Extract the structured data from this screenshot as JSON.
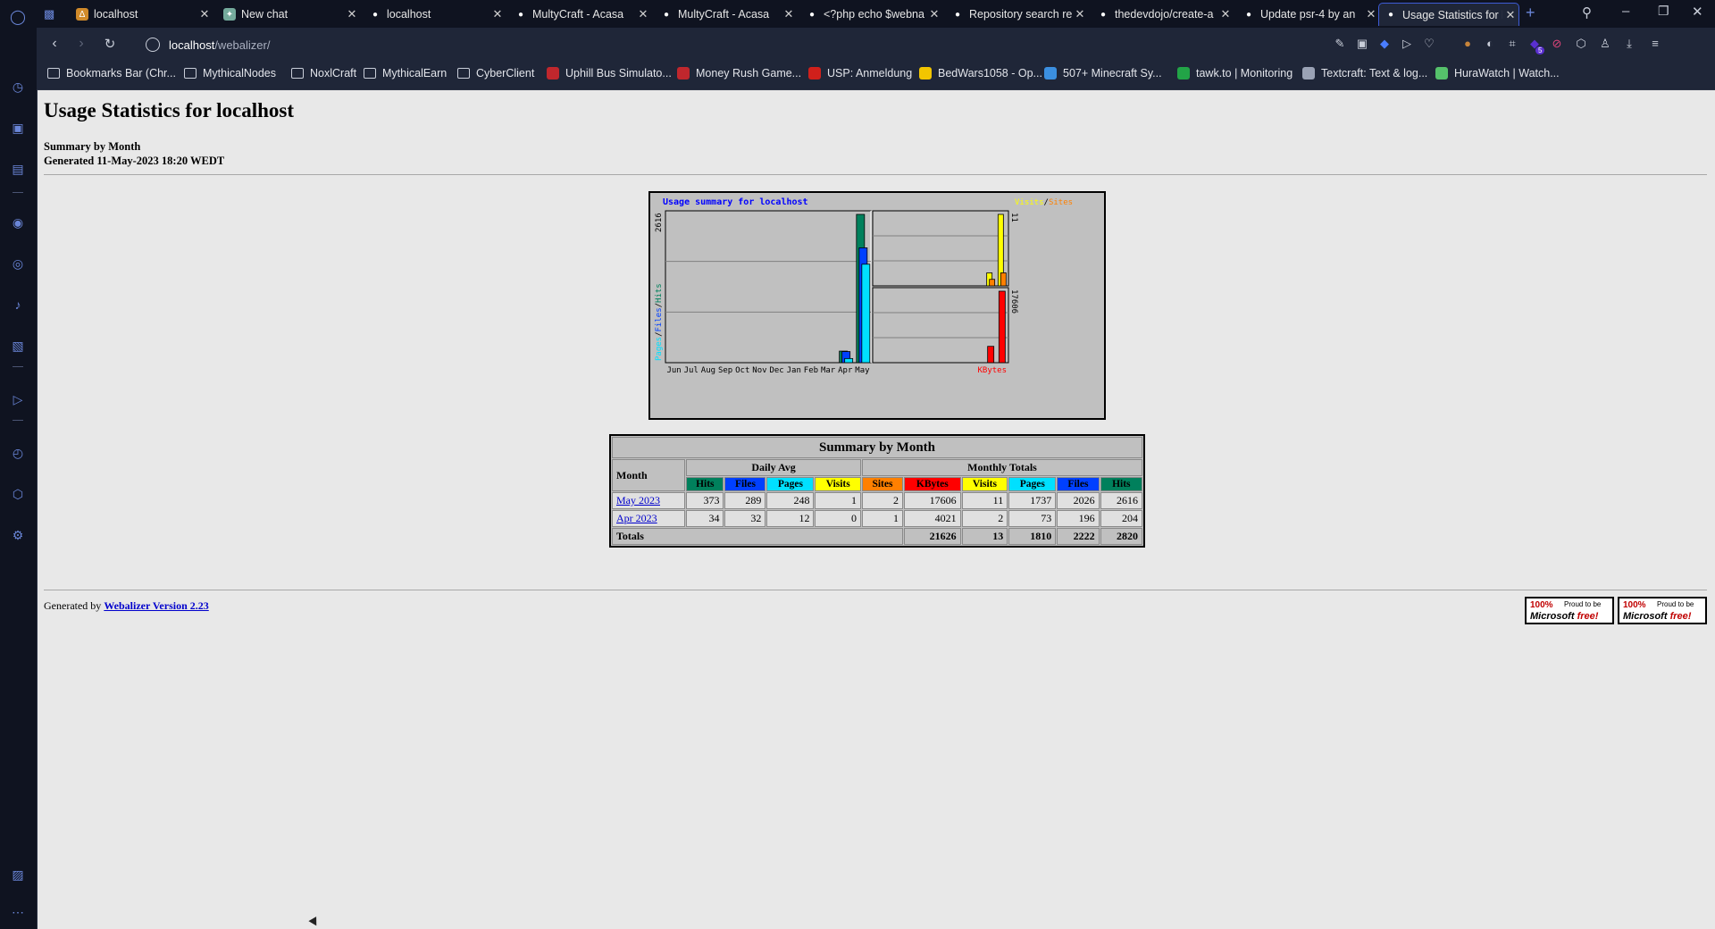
{
  "browser": {
    "tabs": [
      {
        "title": "localhost",
        "favicon_color": "#d08a2a",
        "favicon": "Δ"
      },
      {
        "title": "New chat",
        "favicon_color": "#74aa9c",
        "favicon": "✦"
      },
      {
        "title": "localhost",
        "favicon_color": "#ffffff",
        "favicon": "●"
      },
      {
        "title": "MultyCraft - Acasa",
        "favicon_color": "#ffffff",
        "favicon": "●"
      },
      {
        "title": "MultyCraft - Acasa",
        "favicon_color": "#ffffff",
        "favicon": "●"
      },
      {
        "title": "<?php echo $webna",
        "favicon_color": "#ffffff",
        "favicon": "●"
      },
      {
        "title": "Repository search re",
        "favicon_color": "#ffffff",
        "favicon": "●"
      },
      {
        "title": "thedevdojo/create-a",
        "favicon_color": "#ffffff",
        "favicon": "●"
      },
      {
        "title": "Update psr-4 by an",
        "favicon_color": "#ffffff",
        "favicon": "●"
      },
      {
        "title": "Usage Statistics for l",
        "favicon_color": "#ffffff",
        "favicon": "●"
      }
    ],
    "active_tab_index": 9,
    "address": {
      "host": "localhost",
      "path": "/webalizer/"
    },
    "bookmarks": [
      {
        "label": "Bookmarks Bar (Chr...",
        "kind": "folder"
      },
      {
        "label": "MythicalNodes",
        "kind": "folder"
      },
      {
        "label": "NoxlCraft",
        "kind": "folder"
      },
      {
        "label": "MythicalEarn",
        "kind": "folder"
      },
      {
        "label": "CyberClient",
        "kind": "folder"
      },
      {
        "label": "Uphill Bus Simulato...",
        "kind": "site",
        "color": "#c0272d"
      },
      {
        "label": "Money Rush Game...",
        "kind": "site",
        "color": "#c0272d"
      },
      {
        "label": "USP: Anmeldung",
        "kind": "site",
        "color": "#d0201b"
      },
      {
        "label": "BedWars1058 - Op...",
        "kind": "site",
        "color": "#f2c500"
      },
      {
        "label": "507+ Minecraft Sy...",
        "kind": "site",
        "color": "#3b8fe0"
      },
      {
        "label": "tawk.to | Monitoring",
        "kind": "site",
        "color": "#22a447"
      },
      {
        "label": "Textcraft: Text & log...",
        "kind": "site",
        "color": "#9aa2b5"
      },
      {
        "label": "HuraWatch | Watch...",
        "kind": "site",
        "color": "#55c16b"
      }
    ],
    "sidebar_icons": [
      "speed-dial-icon",
      "briefcase-icon",
      "history-panel-icon",
      "messenger-icon",
      "whatsapp-icon",
      "tiktok-icon",
      "discord-icon",
      "player-icon",
      "clock-icon",
      "cube-icon",
      "settings-icon",
      "gallery-icon",
      "more-icon"
    ],
    "extension_icons": [
      "edit-icon",
      "camera-icon",
      "shield-icon",
      "send-icon",
      "heart-icon",
      "cookie-icon",
      "vpn-icon",
      "puzzle-icon",
      "badge-icon",
      "no-sign-icon",
      "box-icon",
      "profile-icon",
      "download-icon",
      "menu-icon"
    ],
    "extension_badge": "5"
  },
  "page": {
    "title": "Usage Statistics for localhost",
    "subtitle_line1": "Summary by Month",
    "subtitle_line2": "Generated 11-May-2023 18:20 WEDT",
    "footer_prefix": "Generated by ",
    "footer_link": "Webalizer Version 2.23",
    "badge": {
      "big": "100%",
      "small": "Proud to be",
      "line2a": "Microsoft ",
      "line2b": "free!"
    }
  },
  "colors": {
    "hits": "#00805c",
    "files": "#0040ff",
    "pages": "#00e0ff",
    "visits": "#ffff00",
    "sites": "#ff8000",
    "kbytes": "#ff0000",
    "chart_title": "#0000ff"
  },
  "chart_data": {
    "type": "bar",
    "title": "Usage summary for localhost",
    "categories": [
      "Jun",
      "Jul",
      "Aug",
      "Sep",
      "Oct",
      "Nov",
      "Dec",
      "Jan",
      "Feb",
      "Mar",
      "Apr",
      "May"
    ],
    "left_panel": {
      "ylabel_parts": [
        "Pages",
        "Files",
        "Hits"
      ],
      "ymax_label": "2616",
      "ymax": 2616,
      "series": [
        {
          "name": "Hits",
          "values": [
            0,
            0,
            0,
            0,
            0,
            0,
            0,
            0,
            0,
            0,
            204,
            2616
          ]
        },
        {
          "name": "Files",
          "values": [
            0,
            0,
            0,
            0,
            0,
            0,
            0,
            0,
            0,
            0,
            196,
            2026
          ]
        },
        {
          "name": "Pages",
          "values": [
            0,
            0,
            0,
            0,
            0,
            0,
            0,
            0,
            0,
            0,
            73,
            1737
          ]
        }
      ]
    },
    "right_top_panel": {
      "legend_parts": [
        "Visits",
        "Sites"
      ],
      "ymax_label": "11",
      "ymax": 11,
      "series": [
        {
          "name": "Visits",
          "values": [
            0,
            0,
            0,
            0,
            0,
            0,
            0,
            0,
            0,
            0,
            2,
            11
          ]
        },
        {
          "name": "Sites",
          "values": [
            0,
            0,
            0,
            0,
            0,
            0,
            0,
            0,
            0,
            0,
            1,
            2
          ]
        }
      ]
    },
    "right_bottom_panel": {
      "legend": "KBytes",
      "ymax_label": "17606",
      "ymax": 17606,
      "series": [
        {
          "name": "KBytes",
          "values": [
            0,
            0,
            0,
            0,
            0,
            0,
            0,
            0,
            0,
            0,
            4021,
            17606
          ]
        }
      ]
    }
  },
  "table": {
    "caption": "Summary by Month",
    "month_header": "Month",
    "daily_avg_header": "Daily Avg",
    "monthly_totals_header": "Monthly Totals",
    "daily_cols": [
      "Hits",
      "Files",
      "Pages",
      "Visits"
    ],
    "monthly_cols": [
      "Sites",
      "KBytes",
      "Visits",
      "Pages",
      "Files",
      "Hits"
    ],
    "rows": [
      {
        "month": "May 2023",
        "values": [
          "373",
          "289",
          "248",
          "1",
          "2",
          "17606",
          "11",
          "1737",
          "2026",
          "2616"
        ]
      },
      {
        "month": "Apr 2023",
        "values": [
          "34",
          "32",
          "12",
          "0",
          "1",
          "4021",
          "2",
          "73",
          "196",
          "204"
        ]
      }
    ],
    "totals_label": "Totals",
    "totals": [
      "21626",
      "13",
      "1810",
      "2222",
      "2820"
    ]
  }
}
